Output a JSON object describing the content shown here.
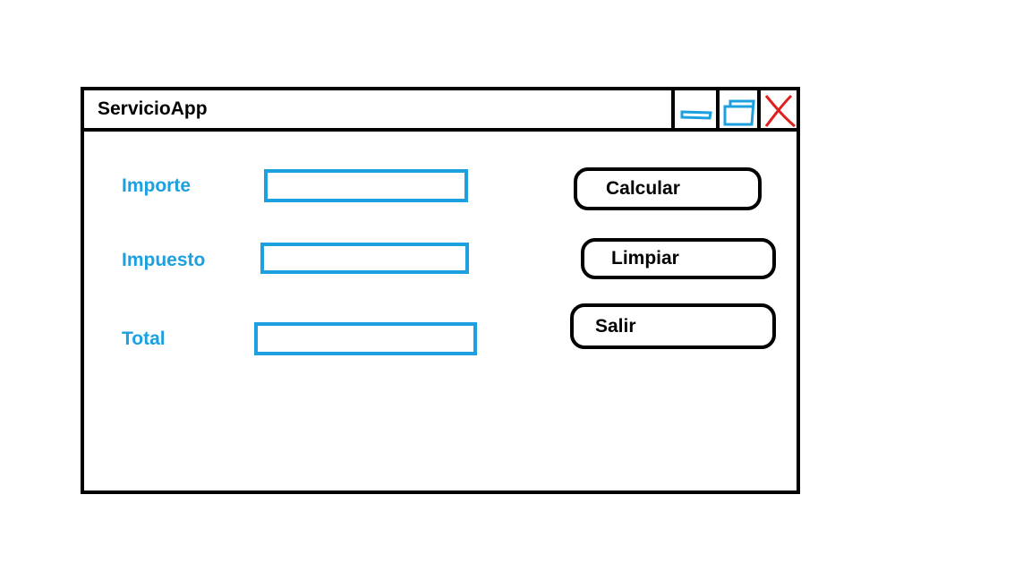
{
  "window": {
    "title": "ServicioApp",
    "controls": {
      "minimize_icon": "minimize-icon",
      "maximize_icon": "maximize-icon",
      "close_icon": "close-icon"
    }
  },
  "form": {
    "fields": [
      {
        "label": "Importe",
        "value": "",
        "placeholder": ""
      },
      {
        "label": "Impuesto",
        "value": "",
        "placeholder": ""
      },
      {
        "label": "Total",
        "value": "",
        "placeholder": ""
      }
    ]
  },
  "actions": {
    "calculate_label": "Calcular",
    "clear_label": "Limpiar",
    "exit_label": "Salir"
  },
  "colors": {
    "accent": "#1ca0e0",
    "close": "#e0201c",
    "border": "#000000"
  }
}
